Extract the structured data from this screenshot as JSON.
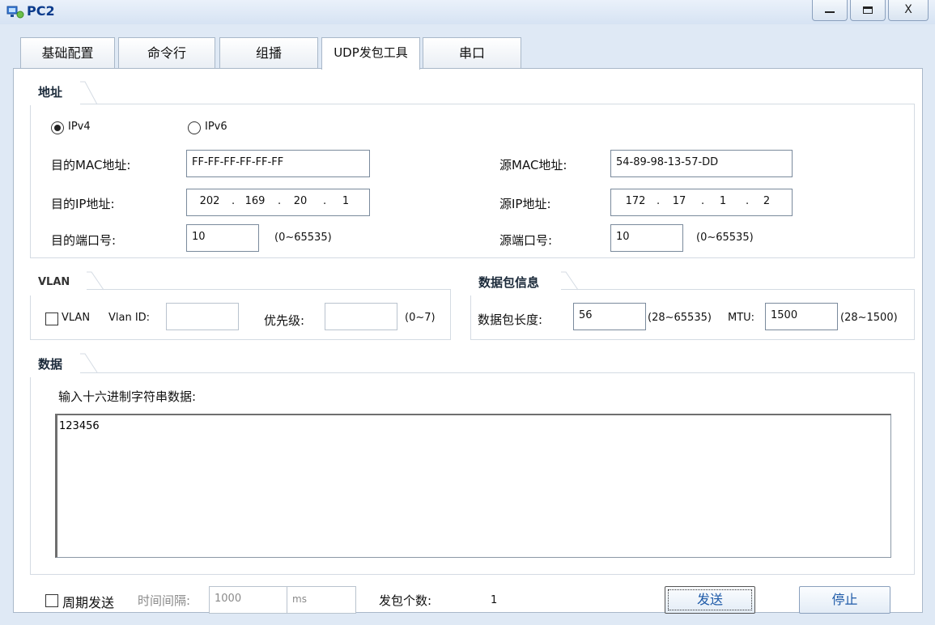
{
  "window": {
    "title": "PC2",
    "minimize_icon": "minimize-icon",
    "maximize_icon": "maximize-icon",
    "close_label": "X"
  },
  "tabs": [
    {
      "label": "基础配置"
    },
    {
      "label": "命令行"
    },
    {
      "label": "组播"
    },
    {
      "label": "UDP发包工具",
      "active": true
    },
    {
      "label": "串口"
    }
  ],
  "address": {
    "title": "地址",
    "ipv4_label": "IPv4",
    "ipv6_label": "IPv6",
    "ipv4_checked": true,
    "dst_mac_label": "目的MAC地址:",
    "dst_mac_value": "FF-FF-FF-FF-FF-FF",
    "src_mac_label": "源MAC地址:",
    "src_mac_value": "54-89-98-13-57-DD",
    "dst_ip_label": "目的IP地址:",
    "dst_ip": [
      "202",
      "169",
      "20",
      "1"
    ],
    "src_ip_label": "源IP地址:",
    "src_ip": [
      "172",
      "17",
      "1",
      "2"
    ],
    "dst_port_label": "目的端口号:",
    "dst_port_value": "10",
    "dst_port_range": "(0~65535)",
    "src_port_label": "源端口号:",
    "src_port_value": "10",
    "src_port_range": "(0~65535)"
  },
  "vlan": {
    "title": "VLAN",
    "checkbox_label": "VLAN",
    "vlan_id_label": "Vlan ID:",
    "vlan_id_value": "",
    "priority_label": "优先级:",
    "priority_value": "",
    "priority_range": "(0~7)"
  },
  "packet_info": {
    "title": "数据包信息",
    "length_label": "数据包长度:",
    "length_value": "56",
    "length_range": "(28~65535)",
    "mtu_label": "MTU:",
    "mtu_value": "1500",
    "mtu_range": "(28~1500)"
  },
  "data": {
    "title": "数据",
    "hex_label": "输入十六进制字符串数据:",
    "hex_value": "123456"
  },
  "footer": {
    "periodic_label": "周期发送",
    "interval_label": "时间间隔:",
    "interval_value": "1000",
    "interval_unit": "ms",
    "count_label": "发包个数:",
    "count_value": "1",
    "send_label": "发送",
    "stop_label": "停止"
  }
}
